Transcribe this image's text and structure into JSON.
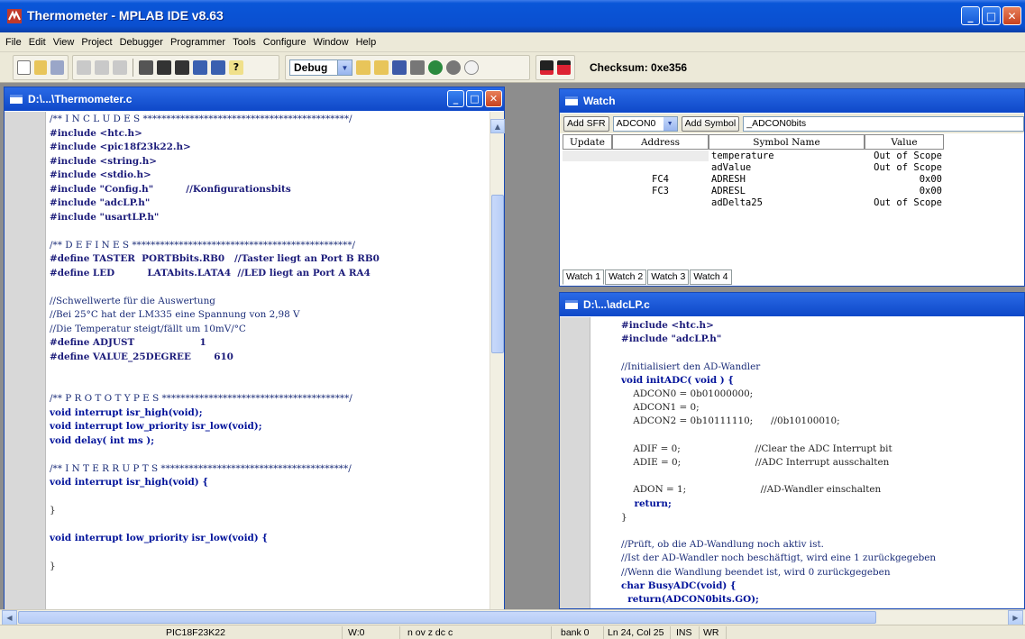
{
  "window": {
    "title": "Thermometer - MPLAB IDE v8.63"
  },
  "menu": [
    "File",
    "Edit",
    "View",
    "Project",
    "Debugger",
    "Programmer",
    "Tools",
    "Configure",
    "Window",
    "Help"
  ],
  "toolbar": {
    "build_config": "Debug",
    "checksum": "Checksum: 0xe356"
  },
  "editor_main": {
    "title": "D:\\...\\Thermometer.c",
    "lines": [
      "/** I N C L U D E S ********************************************/",
      "#include <htc.h>",
      "#include <pic18f23k22.h>",
      "#include <string.h>",
      "#include <stdio.h>",
      "#include \"Config.h\"          //Konfigurationsbits",
      "#include \"adcLP.h\"",
      "#include \"usartLP.h\"",
      "",
      "/** D E F I N E S ***********************************************/",
      "#define TASTER  PORTBbits.RB0   //Taster liegt an Port B RB0",
      "#define LED          LATAbits.LATA4  //LED liegt an Port A RA4",
      "",
      "//Schwellwerte für die Auswertung",
      "//Bei 25°C hat der LM335 eine Spannung von 2,98 V",
      "//Die Temperatur steigt/fällt um 10mV/°C",
      "#define ADJUST                    1",
      "#define VALUE_25DEGREE       610",
      "",
      "",
      "/** P R O T O T Y P E S ****************************************/",
      "void interrupt isr_high(void);",
      "void interrupt low_priority isr_low(void);",
      "void delay( int ms );",
      "",
      "/** I N T E R R U P T S ****************************************/",
      "void interrupt isr_high(void) {",
      "",
      "}",
      "",
      "void interrupt low_priority isr_low(void) {",
      "",
      "}"
    ]
  },
  "watch": {
    "title": "Watch",
    "add_sfr_label": "Add SFR",
    "sfr_selected": "ADCON0",
    "add_symbol_label": "Add Symbol",
    "symbol_selected": "_ADCON0bits",
    "columns": [
      "Update",
      "Address",
      "Symbol Name",
      "Value"
    ],
    "rows": [
      {
        "address": "",
        "symbol": "temperature",
        "value": "Out of Scope"
      },
      {
        "address": "",
        "symbol": "adValue",
        "value": "Out of Scope"
      },
      {
        "address": "FC4",
        "symbol": "ADRESH",
        "value": "0x00"
      },
      {
        "address": "FC3",
        "symbol": "ADRESL",
        "value": "0x00"
      },
      {
        "address": "",
        "symbol": "adDelta25",
        "value": "Out of Scope"
      }
    ],
    "tabs": [
      "Watch 1",
      "Watch 2",
      "Watch 3",
      "Watch 4"
    ]
  },
  "editor_adc": {
    "title": "D:\\...\\adcLP.c",
    "lines": [
      "#include <htc.h>",
      "#include \"adcLP.h\"",
      "",
      "//Initialisiert den AD-Wandler",
      "void initADC( void ) {",
      "    ADCON0 = 0b01000000;",
      "    ADCON1 = 0;",
      "    ADCON2 = 0b10111110;      //0b10100010;",
      "",
      "    ADIF = 0;                         //Clear the ADC Interrupt bit",
      "    ADIE = 0;                         //ADC Interrupt ausschalten",
      "",
      "    ADON = 1;                         //AD-Wandler einschalten",
      "    return;",
      "}",
      "",
      "//Prüft, ob die AD-Wandlung noch aktiv ist.",
      "//Ist der AD-Wandler noch beschäftigt, wird eine 1 zurückgegeben",
      "//Wenn die Wandlung beendet ist, wird 0 zurückgegeben",
      "char BusyADC(void) {",
      "  return(ADCON0bits.GO);"
    ]
  },
  "status": {
    "device": "PIC18F23K22",
    "w": "W:0",
    "flags": "n ov z dc c",
    "bank": "bank 0",
    "position": "Ln 24, Col 25",
    "ins": "INS",
    "wr": "WR"
  }
}
